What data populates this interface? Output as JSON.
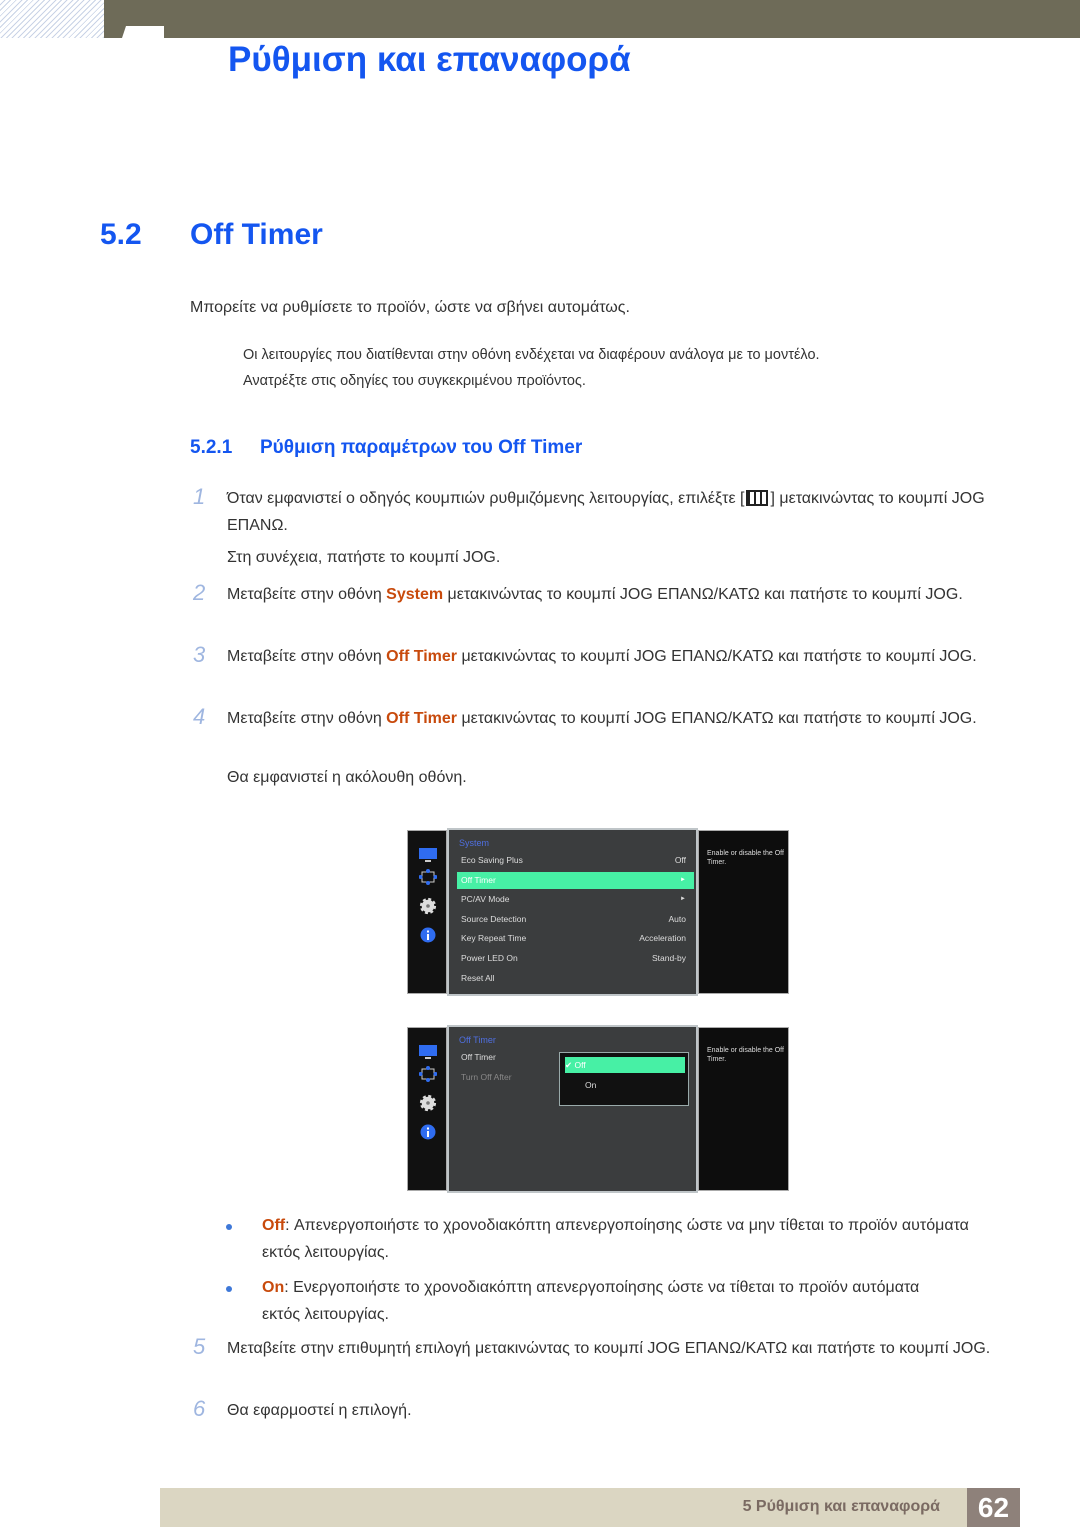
{
  "chapter_title": "Ρύθμιση και επαναφορά",
  "section": {
    "number": "5.2",
    "title": "Off Timer"
  },
  "intro": "Μπορείτε να ρυθμίσετε το προϊόν, ώστε να σβήνει αυτομάτως.",
  "note": [
    "Οι λειτουργίες που διατίθενται στην οθόνη ενδέχεται να διαφέρουν ανάλογα με το μοντέλο.",
    "Ανατρέξτε στις οδηγίες του συγκεκριμένου προϊόντος."
  ],
  "subsection": {
    "number": "5.2.1",
    "title": "Ρύθμιση παραμέτρων του Off Timer"
  },
  "steps": [
    {
      "num": "1",
      "pre": "Όταν εμφανιστεί ο οδηγός κουμπιών ρυθμιζόμενης λειτουργίας, επιλέξτε [",
      "post": "] μετακινώντας το κουμπί JOG ΕΠΑΝΩ.",
      "extra": "Στη συνέχεια, πατήστε το κουμπί JOG."
    },
    {
      "num": "2",
      "pre": "Μεταβείτε στην οθόνη ",
      "hl": "System",
      "post": " μετακινώντας το κουμπί JOG ΕΠΑΝΩ/ΚΑΤΩ και πατήστε το κουμπί JOG."
    },
    {
      "num": "3",
      "pre": "Μεταβείτε στην οθόνη ",
      "hl": "Off Timer",
      "post": " μετακινώντας το κουμπί JOG ΕΠΑΝΩ/ΚΑΤΩ και πατήστε το κουμπί JOG."
    },
    {
      "num": "4",
      "pre": "Μεταβείτε στην οθόνη ",
      "hl": "Off Timer",
      "post": " μετακινώντας το κουμπί JOG ΕΠΑΝΩ/ΚΑΤΩ και πατήστε το κουμπί JOG.",
      "extra": "Θα εμφανιστεί η ακόλουθη οθόνη."
    },
    {
      "num": "5",
      "text": "Μεταβείτε στην επιθυμητή επιλογή μετακινώντας το κουμπί JOG ΕΠΑΝΩ/ΚΑΤΩ και πατήστε το κουμπί JOG."
    },
    {
      "num": "6",
      "text": "Θα εφαρμοστεί η επιλογή."
    }
  ],
  "osd1": {
    "title": "System",
    "help": "Enable or disable the Off Timer.",
    "items": [
      {
        "label": "Eco Saving Plus",
        "value": "Off"
      },
      {
        "label": "Off Timer",
        "value": "►",
        "selected": true
      },
      {
        "label": "PC/AV Mode",
        "value": "►"
      },
      {
        "label": "Source Detection",
        "value": "Auto"
      },
      {
        "label": "Key Repeat Time",
        "value": "Acceleration"
      },
      {
        "label": "Power LED On",
        "value": "Stand-by"
      },
      {
        "label": "Reset All",
        "value": ""
      }
    ]
  },
  "osd2": {
    "title": "Off Timer",
    "help": "Enable or disable the Off Timer.",
    "items": [
      {
        "label": "Off Timer"
      },
      {
        "label": "Turn Off After"
      }
    ],
    "options": [
      {
        "label": "✔ Off",
        "selected": true
      },
      {
        "label": "On"
      }
    ]
  },
  "bullets": [
    {
      "term": "Off",
      "text": ": Απενεργοποιήστε το χρονοδιακόπτη απενεργοποίησης ώστε να μην τίθεται το προϊόν αυτόματα εκτός λειτουργίας."
    },
    {
      "term": "On",
      "text": ": Ενεργοποιήστε το χρονοδιακόπτη απενεργοποίησης ώστε να τίθεται το προϊόν αυτόματα εκτός λειτουργίας."
    }
  ],
  "footer": {
    "chapter": "5 Ρύθμιση και επαναφορά",
    "page": "62"
  }
}
